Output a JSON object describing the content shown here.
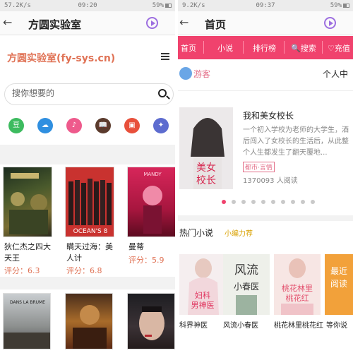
{
  "left": {
    "status": {
      "left": "57.2K/s",
      "time": "09:20",
      "right": "59%"
    },
    "appbar": {
      "back": "←",
      "title": "方圆实验室"
    },
    "site_title": "方圆实验室(fy-sys.cn)",
    "search": {
      "placeholder": "搜你想要的"
    },
    "icons": [
      {
        "name": "douban-icon",
        "glyph": "豆",
        "color": "#3dbb5f"
      },
      {
        "name": "cloud-icon",
        "glyph": "☁",
        "color": "#2f8fe0"
      },
      {
        "name": "music-icon",
        "glyph": "♪",
        "color": "#ee5a8c"
      },
      {
        "name": "book-icon",
        "glyph": "📖",
        "color": "#5b3b2d"
      },
      {
        "name": "tv-icon",
        "glyph": "▣",
        "color": "#e8503b"
      },
      {
        "name": "leaf-icon",
        "glyph": "✦",
        "color": "#5d6ccf"
      }
    ],
    "movies": [
      {
        "title": "狄仁杰之四大天王",
        "score_label": "评分：",
        "score": "6.3"
      },
      {
        "title": "瞒天过海：美人计",
        "score_label": "评分：",
        "score": "6.8"
      },
      {
        "title": "曼蒂",
        "score_label": "评分：",
        "score": "5.9"
      }
    ],
    "row2_texts": [
      "DANS LA BRUME"
    ]
  },
  "right": {
    "status": {
      "left": "9.2K/s",
      "time": "09:37",
      "right": "59%"
    },
    "appbar": {
      "back": "←",
      "title": "首页"
    },
    "nav": [
      "首页",
      "小说",
      "排行榜",
      "🔍搜索",
      "♡充值"
    ],
    "user": {
      "name": "游客",
      "center": "个人中"
    },
    "featured": {
      "title": "我和美女校长",
      "desc": "一个初入学校为老师的大学生，酒后闯入了女校长的生活后，从此整个人生都发生了翻天覆地...",
      "tag": "都市·言情",
      "reads": "1370093 人阅读",
      "cover_text": "我和美女校长"
    },
    "dots": {
      "count": 10,
      "active": 0
    },
    "hot": {
      "title": "热门小说",
      "recommend": "小编力荐"
    },
    "books": [
      {
        "name": "科界神医",
        "cover": "妇科男神医"
      },
      {
        "name": "风流小春医",
        "cover": "风流小春医"
      },
      {
        "name": "桃花林里桃花红",
        "cover": "桃花林里桃花红"
      },
      {
        "name": "等你说",
        "cover": "最近阅读"
      }
    ]
  }
}
